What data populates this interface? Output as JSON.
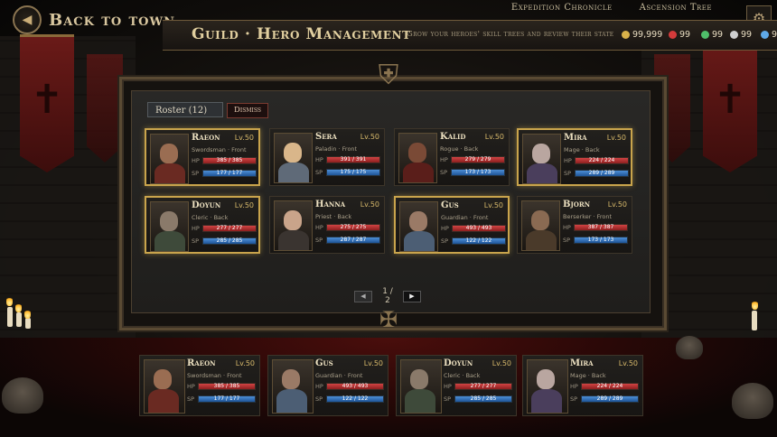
{
  "header": {
    "back_label": "Back to town",
    "title": "Guild · Hero Management",
    "subtitle": "Grow your heroes' skill trees and review their state",
    "nav": [
      "Expedition Chronicle",
      "Ascension Tree"
    ]
  },
  "resources": [
    {
      "icon": "gold-coin-icon",
      "value": "99,999",
      "color": "#d9b24a"
    },
    {
      "icon": "red-cross-icon",
      "value": "99",
      "color": "#d33b3b"
    },
    {
      "icon": "green-cross-icon",
      "value": "99",
      "color": "#4fbf6a"
    },
    {
      "icon": "gear-token-icon",
      "value": "99",
      "color": "#cfcfcf"
    },
    {
      "icon": "blue-crystal-icon",
      "value": "9",
      "color": "#5fa9e8"
    }
  ],
  "tabs": {
    "roster": "Roster (12)",
    "dismiss": "Dismiss"
  },
  "roster": [
    {
      "name": "Raeon",
      "level": "Lv.50",
      "class": "Swordsman · Front",
      "hp": "385 / 385",
      "sp": "177 / 177",
      "hp_pct": 1,
      "sp_pct": 1,
      "selected": true,
      "skin": "#9a6d52",
      "cloth": "#6a2a22"
    },
    {
      "name": "Sera",
      "level": "Lv.50",
      "class": "Paladin · Front",
      "hp": "391 / 391",
      "sp": "175 / 175",
      "hp_pct": 1,
      "sp_pct": 1,
      "selected": false,
      "skin": "#d9b68a",
      "cloth": "#5f6a78"
    },
    {
      "name": "Kalid",
      "level": "Lv.50",
      "class": "Rogue · Back",
      "hp": "279 / 279",
      "sp": "173 / 173",
      "hp_pct": 1,
      "sp_pct": 1,
      "selected": false,
      "skin": "#7a4a36",
      "cloth": "#5a1e1a"
    },
    {
      "name": "Mira",
      "level": "Lv.50",
      "class": "Mage · Back",
      "hp": "224 / 224",
      "sp": "289 / 289",
      "hp_pct": 1,
      "sp_pct": 1,
      "selected": true,
      "skin": "#b9a6a0",
      "cloth": "#4a3e5c"
    },
    {
      "name": "Doyun",
      "level": "Lv.50",
      "class": "Cleric · Back",
      "hp": "277 / 277",
      "sp": "285 / 285",
      "hp_pct": 1,
      "sp_pct": 1,
      "selected": true,
      "skin": "#8a7a6a",
      "cloth": "#3e4a3a"
    },
    {
      "name": "Hanna",
      "level": "Lv.50",
      "class": "Priest · Back",
      "hp": "275 / 275",
      "sp": "287 / 287",
      "hp_pct": 1,
      "sp_pct": 1,
      "selected": false,
      "skin": "#c9a48a",
      "cloth": "#3a3430"
    },
    {
      "name": "Gus",
      "level": "Lv.50",
      "class": "Guardian · Front",
      "hp": "493 / 493",
      "sp": "122 / 122",
      "hp_pct": 1,
      "sp_pct": 1,
      "selected": true,
      "skin": "#9a7a66",
      "cloth": "#4c5e74"
    },
    {
      "name": "Bjorn",
      "level": "Lv.50",
      "class": "Berserker · Front",
      "hp": "387 / 387",
      "sp": "173 / 173",
      "hp_pct": 1,
      "sp_pct": 1,
      "selected": false,
      "skin": "#8a6a52",
      "cloth": "#4a3a2a"
    }
  ],
  "pager": {
    "current": "1 / 2",
    "prev": "◀",
    "next": "▶"
  },
  "party": [
    {
      "name": "Raeon",
      "level": "Lv.50",
      "class": "Swordsman · Front",
      "hp": "385 / 385",
      "sp": "177 / 177",
      "hp_pct": 1,
      "sp_pct": 1,
      "skin": "#9a6d52",
      "cloth": "#6a2a22"
    },
    {
      "name": "Gus",
      "level": "Lv.50",
      "class": "Guardian · Front",
      "hp": "493 / 493",
      "sp": "122 / 122",
      "hp_pct": 1,
      "sp_pct": 1,
      "skin": "#9a7a66",
      "cloth": "#4c5e74"
    },
    {
      "name": "Doyun",
      "level": "Lv.50",
      "class": "Cleric · Back",
      "hp": "277 / 277",
      "sp": "285 / 285",
      "hp_pct": 1,
      "sp_pct": 1,
      "skin": "#8a7a6a",
      "cloth": "#3e4a3a"
    },
    {
      "name": "Mira",
      "level": "Lv.50",
      "class": "Mage · Back",
      "hp": "224 / 224",
      "sp": "289 / 289",
      "hp_pct": 1,
      "sp_pct": 1,
      "skin": "#b9a6a0",
      "cloth": "#4a3e5c"
    }
  ]
}
